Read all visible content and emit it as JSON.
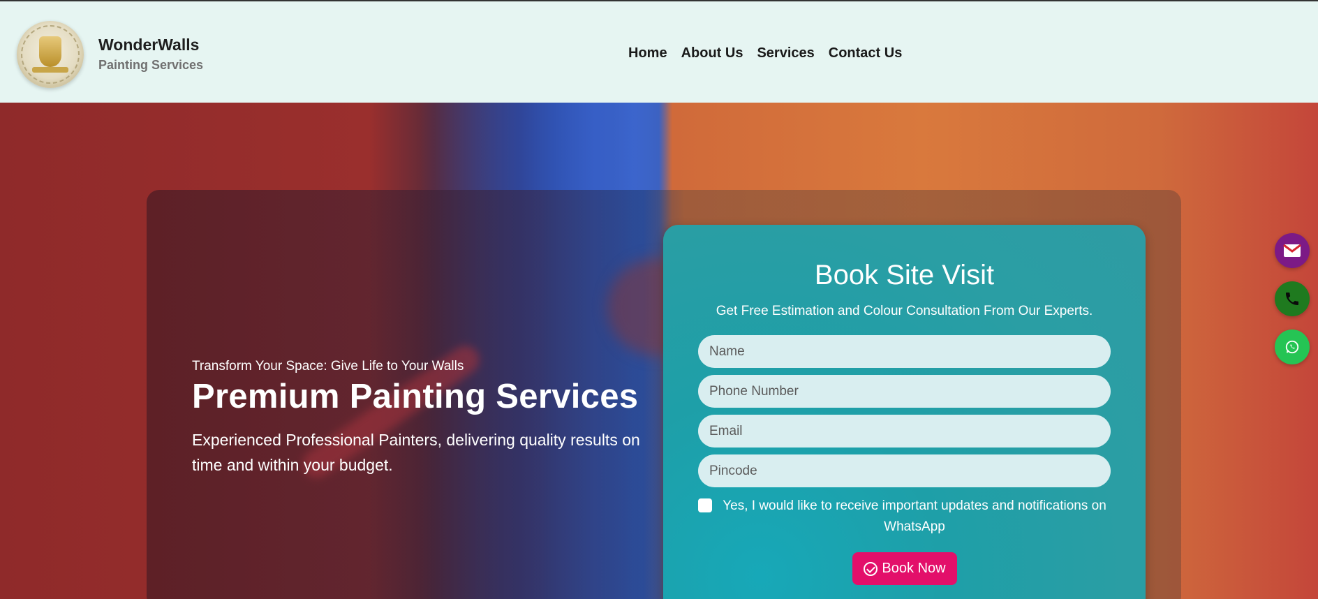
{
  "brand": {
    "name": "WonderWalls",
    "tagline": "Painting Services",
    "logo_icon": "wonderwalls-logo"
  },
  "nav": {
    "items": [
      "Home",
      "About Us",
      "Services",
      "Contact Us"
    ]
  },
  "hero": {
    "tagline": "Transform Your Space: Give Life to Your Walls",
    "title": "Premium Painting Services",
    "description": "Experienced Professional Painters, delivering quality results on time and within your budget."
  },
  "form": {
    "title": "Book Site Visit",
    "subtitle": "Get Free Estimation and Colour Consultation From Our Experts.",
    "fields": {
      "name": "Name",
      "phone": "Phone Number",
      "email": "Email",
      "pincode": "Pincode"
    },
    "consent": "Yes, I would like to receive important updates and notifications on WhatsApp",
    "submit": "Book Now",
    "submit_icon": "check-circle-icon"
  },
  "floating": {
    "mail_icon": "mail-icon",
    "phone_icon": "phone-icon",
    "whatsapp_icon": "whatsapp-icon"
  },
  "colors": {
    "header_bg": "#e6f5f2",
    "form_bg": "#2a9ea4",
    "button_pink": "#e30f6a",
    "mail_purple": "#7c1a86",
    "phone_green": "#1f7a1f",
    "whatsapp_green": "#25c454"
  }
}
